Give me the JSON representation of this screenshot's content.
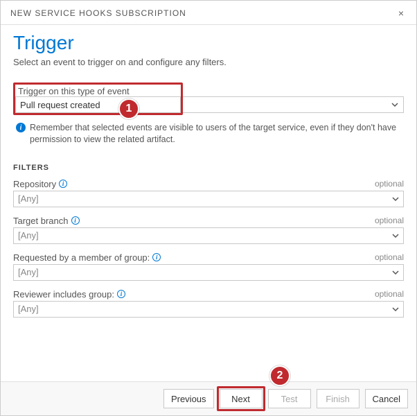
{
  "dialog": {
    "title": "NEW SERVICE HOOKS SUBSCRIPTION",
    "close_glyph": "×"
  },
  "page": {
    "heading": "Trigger",
    "subtitle": "Select an event to trigger on and configure any filters."
  },
  "event": {
    "label": "Trigger on this type of event",
    "selected": "Pull request created"
  },
  "info": {
    "icon_label": "i",
    "text": "Remember that selected events are visible to users of the target service, even if they don't have permission to view the related artifact."
  },
  "filters": {
    "heading": "FILTERS",
    "optional_label": "optional",
    "help_glyph": "i",
    "fields": [
      {
        "key": "repository",
        "label": "Repository",
        "value": "[Any]",
        "has_help": true
      },
      {
        "key": "target_branch",
        "label": "Target branch",
        "value": "[Any]",
        "has_help": true
      },
      {
        "key": "requested_by_group",
        "label": "Requested by a member of group:",
        "value": "[Any]",
        "has_help": true
      },
      {
        "key": "reviewer_group",
        "label": "Reviewer includes group:",
        "value": "[Any]",
        "has_help": true
      }
    ]
  },
  "callouts": {
    "one": "1",
    "two": "2"
  },
  "buttons": {
    "previous": "Previous",
    "next": "Next",
    "test": "Test",
    "finish": "Finish",
    "cancel": "Cancel"
  }
}
